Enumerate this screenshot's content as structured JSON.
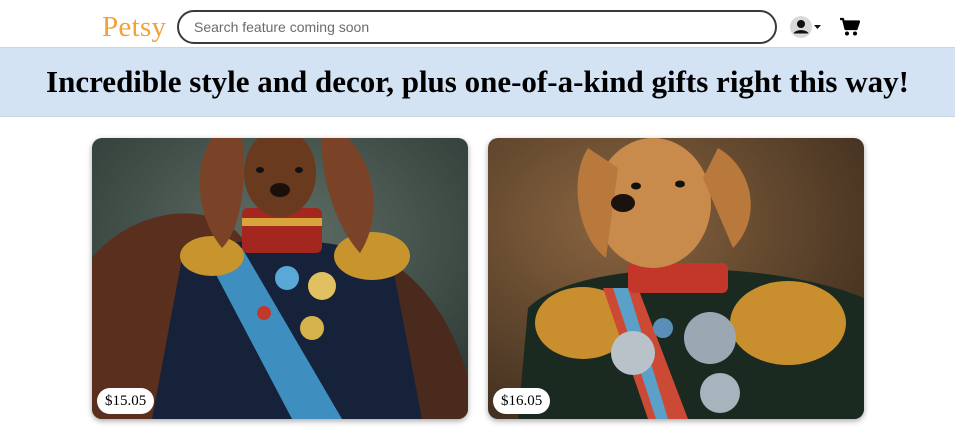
{
  "header": {
    "logo": "Petsy",
    "search": {
      "placeholder": "Search feature coming soon",
      "value": ""
    },
    "account_icon": "user-circle-icon",
    "dropdown_icon": "caret-down-icon",
    "cart_icon": "shopping-cart-icon",
    "logo_color": "#f1a23a"
  },
  "banner": {
    "text": "Incredible style and decor, plus one-of-a-kind gifts right this way!",
    "background": "#d3e3f3"
  },
  "products": [
    {
      "price": "$15.05",
      "image": "dog-military-portrait-spaniel"
    },
    {
      "price": "$16.05",
      "image": "dog-military-portrait-labrador"
    }
  ]
}
